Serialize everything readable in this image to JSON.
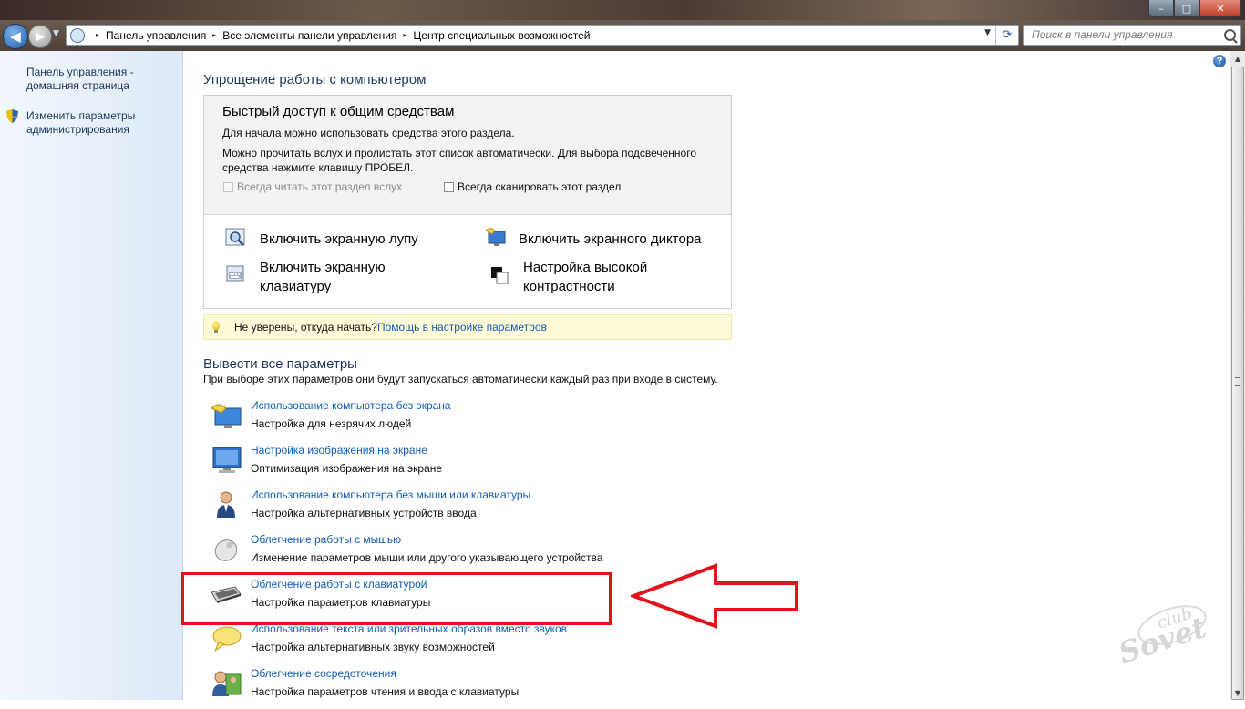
{
  "window": {
    "minimize": "–",
    "maximize": "□",
    "close": "✕"
  },
  "address_bar": {
    "crumbs": [
      "Панель управления",
      "Все элементы панели управления",
      "Центр специальных возможностей"
    ],
    "separator": "▸"
  },
  "search": {
    "placeholder": "Поиск в панели управления"
  },
  "sidebar": {
    "home_link": [
      "Панель управления -",
      "домашняя страница"
    ],
    "admin_link": [
      "Изменить параметры",
      "администрирования"
    ]
  },
  "main": {
    "section1_title": "Упрощение работы с компьютером",
    "quick_access": {
      "title": "Быстрый доступ к общим средствам",
      "line1": "Для начала можно использовать средства этого раздела.",
      "line2": [
        "Можно прочитать вслух и пролистать этот список автоматически. Для выбора подсвеченного",
        "средства нажмите клавишу ПРОБЕЛ."
      ],
      "checkbox_read": "Всегда читать этот раздел вслух",
      "checkbox_scan": "Всегда сканировать этот раздел",
      "tools": {
        "magnifier": "Включить экранную лупу",
        "narrator": "Включить экранного диктора",
        "keyboard": [
          "Включить экранную",
          "клавиатуру"
        ],
        "contrast": [
          "Настройка высокой",
          "контрастности"
        ]
      }
    },
    "tip": {
      "question": "Не уверены, откуда начать?",
      "link": "Помощь в настройке параметров"
    },
    "section2_title": "Вывести все параметры",
    "section2_subtitle": "При выборе этих параметров они будут запускаться автоматически каждый раз при входе в систему.",
    "items": [
      {
        "title": "Использование компьютера без экрана",
        "desc": "Настройка для незрячих людей",
        "icon": "speaker-monitor-icon"
      },
      {
        "title": "Настройка изображения на экране",
        "desc": "Оптимизация изображения на экране",
        "icon": "monitor-icon"
      },
      {
        "title": "Использование компьютера без мыши или клавиатуры",
        "desc": "Настройка альтернативных устройств ввода",
        "icon": "person-icon"
      },
      {
        "title": "Облегчение работы с мышью",
        "desc": "Изменение параметров мыши или другого указывающего устройства",
        "icon": "mouse-icon"
      },
      {
        "title": "Облегчение работы с клавиатурой",
        "desc": "Настройка параметров клавиатуры",
        "icon": "keyboard-icon"
      },
      {
        "title": "Использование текста или зрительных образов вместо звуков",
        "desc": "Настройка альтернативных звуку возможностей",
        "icon": "speech-bubble-icon"
      },
      {
        "title": "Облегчение сосредоточения",
        "desc": "Настройка параметров чтения и ввода с клавиатуры",
        "icon": "people-icon"
      }
    ]
  },
  "watermark": {
    "line1": "club",
    "line2": "Sovet"
  },
  "colors": {
    "link": "#0f5db3",
    "heading": "#1e395b",
    "annotation": "#e1141c",
    "tip_bg": "#fffbd8"
  }
}
